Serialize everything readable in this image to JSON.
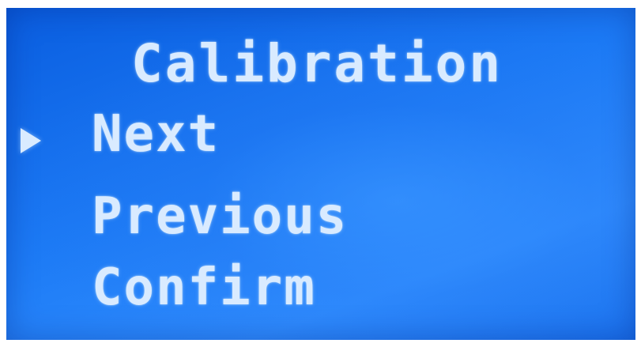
{
  "screen": {
    "title": "Calibration",
    "selected_indicator_icon": "right-triangle-cursor-icon",
    "background_color": "#1c7af5",
    "text_color": "#d9ebff"
  },
  "menu": {
    "selected_index": 0,
    "items": [
      {
        "label": "Next"
      },
      {
        "label": "Previous"
      },
      {
        "label": "Confirm"
      }
    ]
  }
}
